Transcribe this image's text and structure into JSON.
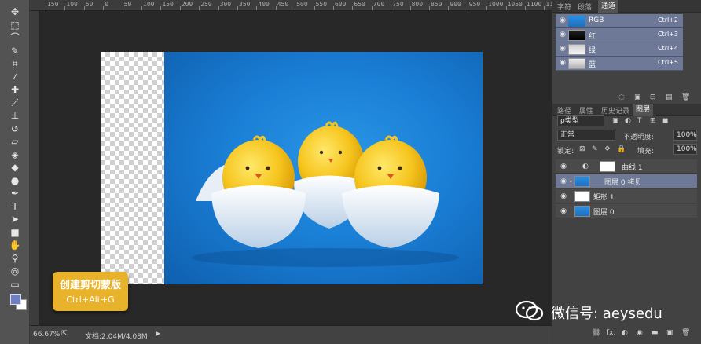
{
  "toolbar": {
    "tools": [
      {
        "name": "move-tool-icon",
        "glyph": "✥"
      },
      {
        "name": "marquee-tool-icon",
        "glyph": "⬚"
      },
      {
        "name": "lasso-tool-icon",
        "glyph": "⌒"
      },
      {
        "name": "quick-select-tool-icon",
        "glyph": "✎"
      },
      {
        "name": "crop-tool-icon",
        "glyph": "⌗"
      },
      {
        "name": "eyedropper-tool-icon",
        "glyph": "⁄"
      },
      {
        "name": "healing-brush-tool-icon",
        "glyph": "✚"
      },
      {
        "name": "brush-tool-icon",
        "glyph": "⟋"
      },
      {
        "name": "clone-stamp-tool-icon",
        "glyph": "⊥"
      },
      {
        "name": "history-brush-tool-icon",
        "glyph": "↺"
      },
      {
        "name": "eraser-tool-icon",
        "glyph": "▱"
      },
      {
        "name": "paint-bucket-tool-icon",
        "glyph": "◈"
      },
      {
        "name": "blur-tool-icon",
        "glyph": "◆"
      },
      {
        "name": "dodge-tool-icon",
        "glyph": "●"
      },
      {
        "name": "pen-tool-icon",
        "glyph": "✒"
      },
      {
        "name": "type-tool-icon",
        "glyph": "T"
      },
      {
        "name": "path-select-tool-icon",
        "glyph": "➤"
      },
      {
        "name": "shape-tool-icon",
        "glyph": "■"
      },
      {
        "name": "hand-tool-icon",
        "glyph": "✋"
      },
      {
        "name": "zoom-tool-icon",
        "glyph": "⚲"
      },
      {
        "name": "quick-mask-icon",
        "glyph": "◎"
      },
      {
        "name": "screen-mode-icon",
        "glyph": "▭"
      }
    ],
    "fg_color": "#6f7fc4",
    "bg_color": "#ffffff"
  },
  "ruler": {
    "labels": [
      "150",
      "100",
      "50",
      "0",
      "50",
      "100",
      "150",
      "200",
      "250",
      "300",
      "350",
      "400",
      "450",
      "500",
      "550",
      "600",
      "650",
      "700",
      "750",
      "800",
      "850",
      "900",
      "950",
      "1000",
      "1050",
      "1100",
      "1150"
    ]
  },
  "tooltip": {
    "line1": "创建剪切蒙版",
    "line2": "Ctrl+Alt+G"
  },
  "status": {
    "zoom": "66.67%",
    "doc_size": "文档:2.04M/4.08M",
    "arrow": "▶"
  },
  "channels_panel": {
    "tabs": [
      "字符",
      "段落",
      "通道"
    ],
    "active_tab": "通道",
    "rows": [
      {
        "name": "RGB",
        "shortcut": "Ctrl+2"
      },
      {
        "name": "红",
        "shortcut": "Ctrl+3"
      },
      {
        "name": "绿",
        "shortcut": "Ctrl+4"
      },
      {
        "name": "蓝",
        "shortcut": "Ctrl+5"
      }
    ],
    "bottom_icons": [
      "◌",
      "▣",
      "⊟",
      "▤",
      "🗑"
    ]
  },
  "layers_panel": {
    "tabs": [
      "路径",
      "属性",
      "历史记录",
      "图层"
    ],
    "active_tab": "图层",
    "filter_label": "ρ类型",
    "filter_icons": [
      "▣",
      "◐",
      "T",
      "⊞",
      "◼"
    ],
    "blend_mode": "正常",
    "opacity_label": "不透明度:",
    "opacity_value": "100%",
    "lock_label": "锁定:",
    "lock_icons": [
      "⊠",
      "✎",
      "✥",
      "🔒"
    ],
    "fill_label": "填充:",
    "fill_value": "100%",
    "layers": [
      {
        "name": "曲线 1",
        "selected": false
      },
      {
        "name": "图层 0 拷贝",
        "selected": true
      },
      {
        "name": "矩形 1",
        "selected": false
      },
      {
        "name": "图层 0",
        "selected": false
      }
    ],
    "bottom_icons": [
      "⛓",
      "fx.",
      "◐",
      "◉",
      "▬",
      "▣",
      "🗑"
    ]
  },
  "watermark": {
    "text": "微信号: aeysedu"
  }
}
